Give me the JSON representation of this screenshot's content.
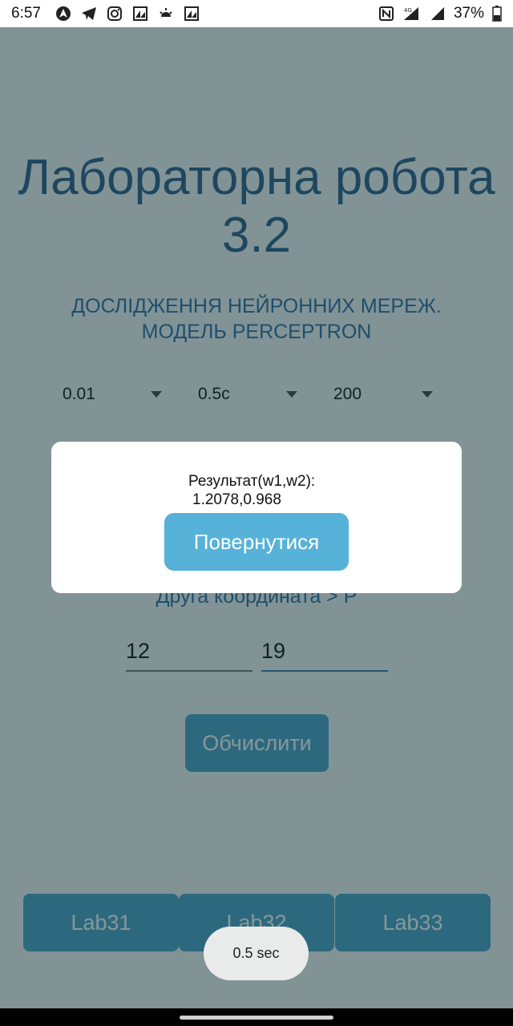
{
  "status_bar": {
    "time": "6:57",
    "battery_percent": "37%",
    "network_type": "4G",
    "left_icons": [
      "nav-arrow-icon",
      "telegram-icon",
      "instagram-icon",
      "image-icon",
      "weather-icon",
      "image-icon"
    ],
    "right_icons": [
      "nfc-icon",
      "signal-icon",
      "signal-icon",
      "battery-icon"
    ]
  },
  "app": {
    "title": "Лабораторна робота 3.2",
    "subtitle_line1": "ДОСЛІДЖЕННЯ НЕЙРОННИХ МЕРЕЖ.",
    "subtitle_line2": "МОДЕЛЬ PERCEPTRON",
    "spinners": [
      {
        "value": "0.01"
      },
      {
        "value": "0.5с"
      },
      {
        "value": "200"
      }
    ],
    "coord_label": "Друга координата > P",
    "inputs": [
      {
        "value": "12"
      },
      {
        "value": "19"
      }
    ],
    "calc_button": "Обчислити",
    "lab_buttons": [
      "Lab31",
      "Lab32",
      "Lab33"
    ]
  },
  "dialog": {
    "result_label": "Результат(w1,w2):",
    "result_value": "1.2078,0.968",
    "back_button": "Повернутися"
  },
  "toast": {
    "text": "0.5 sec"
  },
  "colors": {
    "title": "#2d5f8b",
    "subtitle": "#2d6da4",
    "button": "#4ba2c8",
    "dialog_button": "#56b2d8",
    "overlay": "rgba(16,48,52,0.5)"
  }
}
